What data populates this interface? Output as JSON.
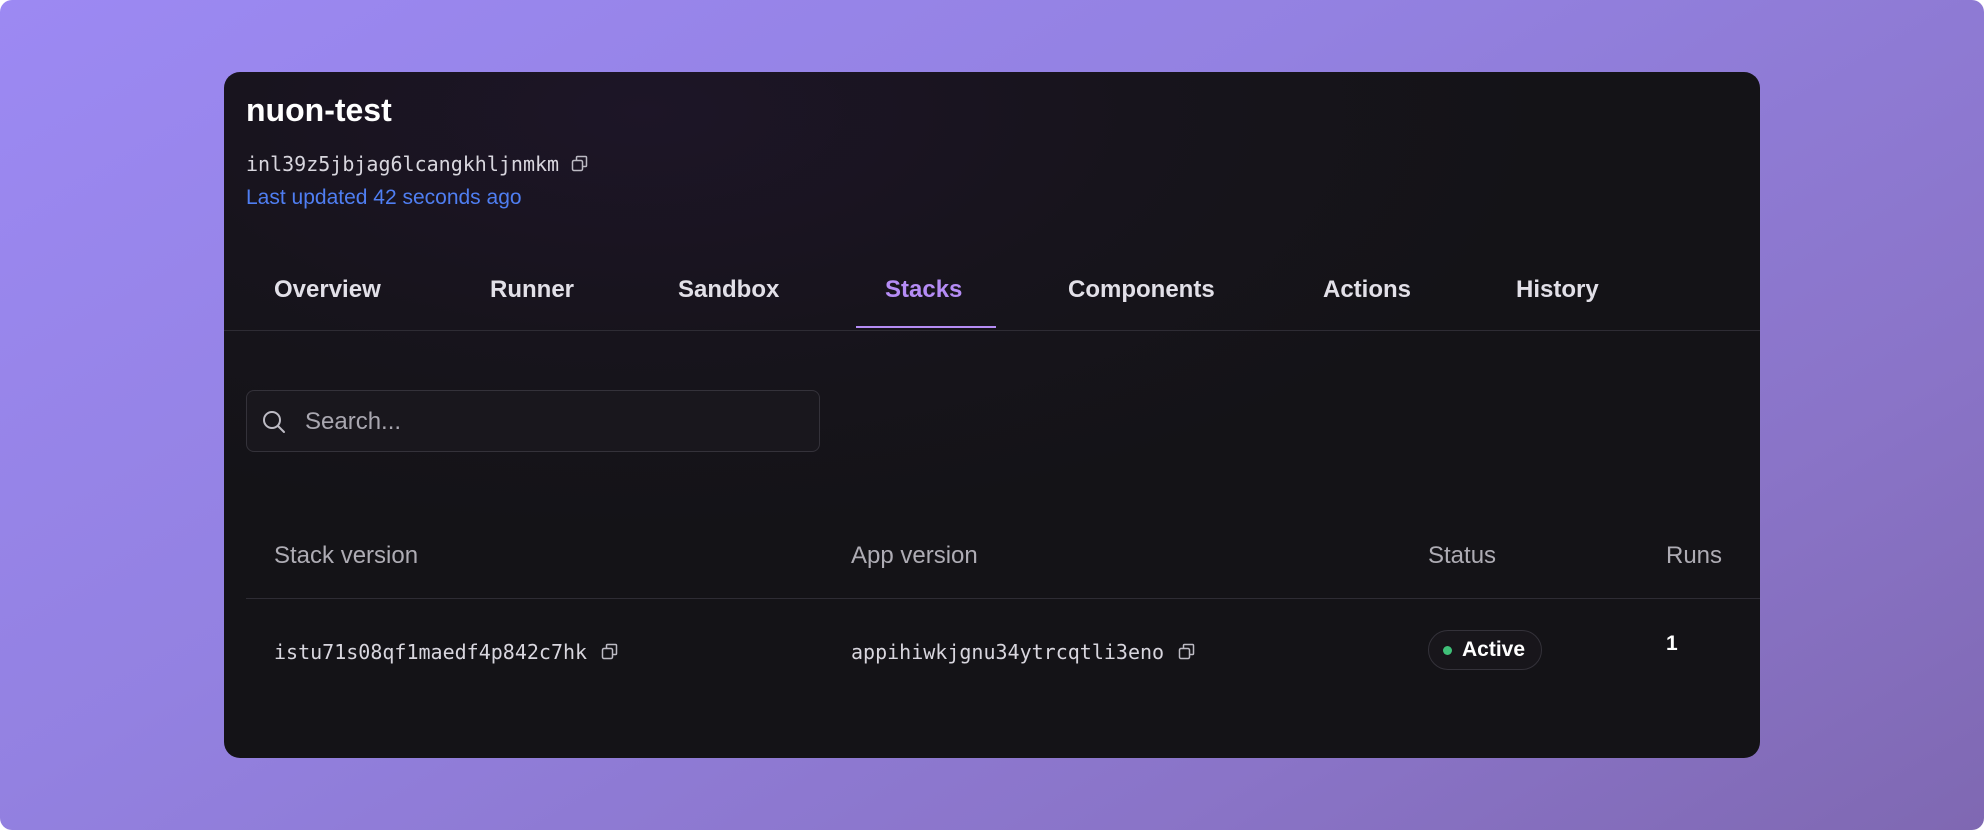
{
  "install": {
    "name": "nuon-test",
    "id": "inl39z5jbjag6lcangkhljnmkm",
    "last_updated": "Last updated 42 seconds ago"
  },
  "tabs": [
    {
      "label": "Overview",
      "active": false
    },
    {
      "label": "Runner",
      "active": false
    },
    {
      "label": "Sandbox",
      "active": false
    },
    {
      "label": "Stacks",
      "active": true
    },
    {
      "label": "Components",
      "active": false
    },
    {
      "label": "Actions",
      "active": false
    },
    {
      "label": "History",
      "active": false
    }
  ],
  "search": {
    "placeholder": "Search...",
    "value": ""
  },
  "table": {
    "columns": [
      "Stack version",
      "App version",
      "Status",
      "Runs"
    ],
    "rows": [
      {
        "stack_version": "istu71s08qf1maedf4p842c7hk",
        "app_version": "appihiwkjgnu34ytrcqtli3eno",
        "status": "Active",
        "runs": "1"
      }
    ]
  },
  "colors": {
    "accent": "#b58cf5",
    "link": "#4f7ef2",
    "status_active": "#3fbf78"
  },
  "icons": {
    "copy": "copy-icon",
    "search": "search-icon"
  }
}
